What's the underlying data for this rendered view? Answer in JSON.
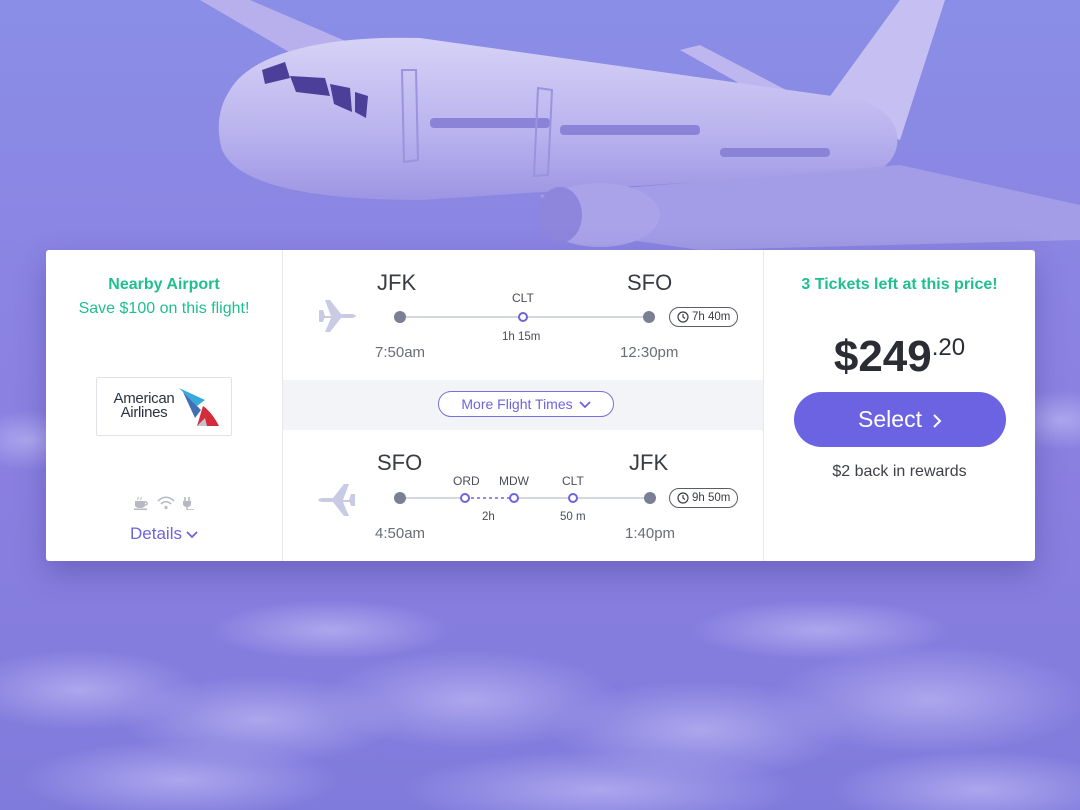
{
  "colors": {
    "accent": "#6c63e3",
    "green": "#1fbf8f",
    "background": "#8a84e2"
  },
  "left": {
    "nearby_title": "Nearby Airport",
    "nearby_sub": "Save $100 on this flight!",
    "airline_logo": {
      "line1": "American",
      "line2": "Airlines",
      "icon": "american-airlines-eagle-icon"
    },
    "amenities": [
      "coffee-icon",
      "wifi-icon",
      "power-outlet-icon"
    ],
    "details_label": "Details"
  },
  "outbound": {
    "from": "JFK",
    "to": "SFO",
    "depart": "7:50am",
    "arrive": "12:30pm",
    "stops": [
      {
        "code": "CLT",
        "layover": "1h 15m"
      }
    ],
    "duration": "7h 40m"
  },
  "more_flight_times_label": "More Flight Times",
  "inbound": {
    "from": "SFO",
    "to": "JFK",
    "depart": "4:50am",
    "arrive": "1:40pm",
    "stops": [
      {
        "code": "ORD"
      },
      {
        "code": "MDW",
        "layover": "2h"
      },
      {
        "code": "CLT",
        "layover": "50 m"
      }
    ],
    "duration": "9h 50m"
  },
  "right": {
    "tickets_left": "3 Tickets left at this price!",
    "price_dollars": "$249",
    "price_cents": ".20",
    "select_label": "Select",
    "rewards": "$2 back in rewards"
  }
}
